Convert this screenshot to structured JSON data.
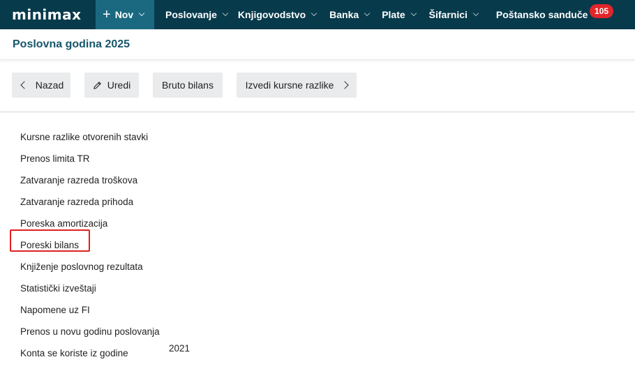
{
  "app": {
    "logo": "minimax"
  },
  "nav": {
    "new_label": "Nov",
    "items": [
      {
        "label": "Poslovanje"
      },
      {
        "label": "Knjigovodstvo"
      },
      {
        "label": "Banka"
      },
      {
        "label": "Plate"
      },
      {
        "label": "Šifarnici"
      },
      {
        "label": "Poštansko sanduče"
      }
    ],
    "inbox_badge": "105"
  },
  "page": {
    "title": "Poslovna godina 2025"
  },
  "toolbar": {
    "back_label": "Nazad",
    "edit_label": "Uredi",
    "gross_balance_label": "Bruto bilans",
    "exchange_diff_label": "Izvedi kursne razlike"
  },
  "list": {
    "items": [
      {
        "label": "Kursne razlike otvorenih stavki"
      },
      {
        "label": "Prenos limita TR"
      },
      {
        "label": "Zatvaranje razreda troškova"
      },
      {
        "label": "Zatvaranje razreda prihoda"
      },
      {
        "label": "Poreska amortizacija"
      },
      {
        "label": "Poreski bilans"
      },
      {
        "label": "Knjiženje poslovnog rezultata"
      },
      {
        "label": "Statistički izveštaji"
      },
      {
        "label": "Napomene uz FI"
      },
      {
        "label": "Prenos u novu godinu poslovanja"
      },
      {
        "label": "Konta se koriste iz godine"
      }
    ],
    "accounts_year_value": "2021"
  },
  "colors": {
    "nav_bg": "#073b4c",
    "nav_new_bg": "#1a6980",
    "title": "#17566b",
    "badge": "#e1252a",
    "highlight": "#e02020"
  },
  "icons": {
    "back": "chevron-left-icon",
    "edit": "pencil-icon",
    "forward": "chevron-right-icon",
    "new": "plus-icon"
  }
}
